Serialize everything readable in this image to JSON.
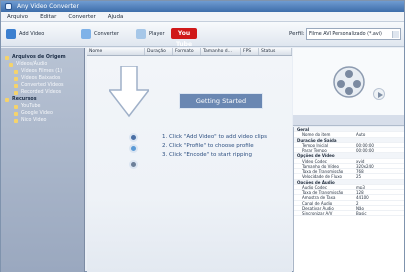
{
  "window": {
    "title": "Any Video Converter"
  },
  "menu": [
    {
      "name": "arquivo",
      "label": "Arquivo"
    },
    {
      "name": "editar",
      "label": "Editar"
    },
    {
      "name": "converter",
      "label": "Converter"
    },
    {
      "name": "ajuda",
      "label": "Ajuda"
    }
  ],
  "toolbar": {
    "add_video_label": "Add Video",
    "convert_label": "Converter",
    "player_label": "Player",
    "youtube_label": "You Tube",
    "profile_label": "Perfil:",
    "profile_value": "Filme AVI Personalizado (*.avi)"
  },
  "sidebar": {
    "items": [
      {
        "label": "Arquivos de Origem",
        "root": true
      },
      {
        "label": "Vídeos/Áudio",
        "root": false
      },
      {
        "label": "Vídeos Filmes (1)",
        "root": false
      },
      {
        "label": "Vídeos Baixados",
        "root": false
      },
      {
        "label": "Converted Vídeos",
        "root": false
      },
      {
        "label": "Recorded Vídeos",
        "root": false
      },
      {
        "label": "Recursos",
        "root": true
      },
      {
        "label": "YouTube",
        "root": false
      },
      {
        "label": "Google Video",
        "root": false
      },
      {
        "label": "Nico Video",
        "root": false
      }
    ]
  },
  "list_header": {
    "columns": [
      "Nome",
      "Duração",
      "Formato",
      "Tamanho d...",
      "FPS",
      "Status"
    ]
  },
  "main": {
    "getting_started": "Getting Started",
    "steps": [
      "1. Click \"Add Video\" to add video clips",
      "2. Click \"Profile\" to choose profile",
      "3. Click \"Encode\" to start ripping"
    ]
  },
  "properties": {
    "rows": [
      {
        "type": "section",
        "key": "Geral",
        "value": ""
      },
      {
        "type": "row",
        "key": "Nome do item",
        "value": "Auto"
      },
      {
        "type": "section",
        "key": "Duração de Saída",
        "value": ""
      },
      {
        "type": "row",
        "key": "Tempo Inicial",
        "value": "00:00:00"
      },
      {
        "type": "row",
        "key": "Parar Tempo",
        "value": "00:00:00"
      },
      {
        "type": "section",
        "key": "Opções de Vídeo",
        "value": ""
      },
      {
        "type": "row",
        "key": "Vídeo Codec",
        "value": "xvid"
      },
      {
        "type": "row",
        "key": "Tamanho do Vídeo",
        "value": "320x240"
      },
      {
        "type": "row",
        "key": "Taxa de Transmissão",
        "value": "768"
      },
      {
        "type": "row",
        "key": "Velocidade de Fluxo",
        "value": "25"
      },
      {
        "type": "section",
        "key": "Opções de Áudio",
        "value": ""
      },
      {
        "type": "row",
        "key": "Áudio Codec",
        "value": "mp3"
      },
      {
        "type": "row",
        "key": "Taxa de Transmissão",
        "value": "128"
      },
      {
        "type": "row",
        "key": "Amostra de Taxa",
        "value": "44100"
      },
      {
        "type": "row",
        "key": "Canal de Áudio",
        "value": "2"
      },
      {
        "type": "row",
        "key": "Desativar Áudio",
        "value": "Não"
      },
      {
        "type": "row",
        "key": "Sincronizar A/V",
        "value": "Basic"
      }
    ]
  }
}
